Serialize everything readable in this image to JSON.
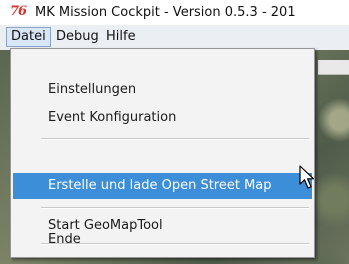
{
  "window": {
    "icon_glyph": "76",
    "icon_name": "app-logo-icon",
    "title": "MK Mission Cockpit - Version 0.5.3 - 201"
  },
  "menubar": {
    "items": [
      {
        "label": "Datei",
        "open": true
      },
      {
        "label": "Debug"
      },
      {
        "label": "Hilfe"
      }
    ]
  },
  "dropdown": {
    "items": [
      {
        "label": "Einstellungen"
      },
      {
        "label": "Event Konfiguration"
      },
      {
        "label": "Erstelle und lade Open Street Map",
        "highlighted": true
      },
      {
        "label": "Start GeoMapTool"
      },
      {
        "label": "Ende"
      }
    ]
  },
  "colors": {
    "highlight": "#3c8ed8",
    "menubar_bg": "#ebeef3",
    "icon_red": "#d8332c"
  },
  "cursor_icon": "arrow-cursor-icon"
}
